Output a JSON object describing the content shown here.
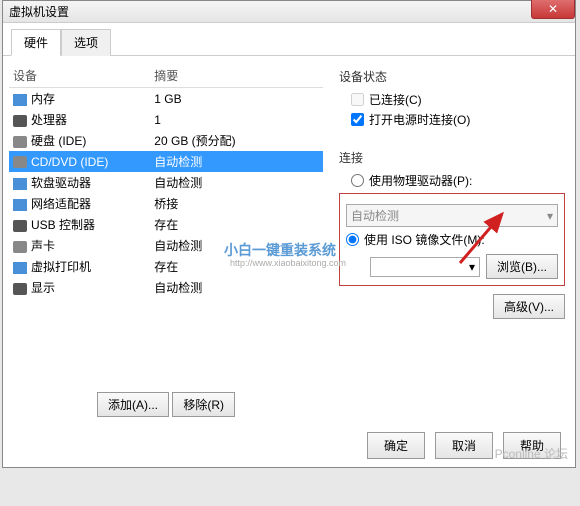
{
  "window_title": "虚拟机设置",
  "tabs": {
    "hardware": "硬件",
    "options": "选项"
  },
  "columns": {
    "device": "设备",
    "summary": "摘要"
  },
  "devices": [
    {
      "name": "内存",
      "summary": "1 GB",
      "icon": "blue"
    },
    {
      "name": "处理器",
      "summary": "1",
      "icon": "dark"
    },
    {
      "name": "硬盘 (IDE)",
      "summary": "20 GB (预分配)",
      "icon": "disk"
    },
    {
      "name": "CD/DVD (IDE)",
      "summary": "自动检测",
      "icon": "disk",
      "selected": true
    },
    {
      "name": "软盘驱动器",
      "summary": "自动检测",
      "icon": "blue"
    },
    {
      "name": "网络适配器",
      "summary": "桥接",
      "icon": "blue"
    },
    {
      "name": "USB 控制器",
      "summary": "存在",
      "icon": "dark"
    },
    {
      "name": "声卡",
      "summary": "自动检测",
      "icon": "disk"
    },
    {
      "name": "虚拟打印机",
      "summary": "存在",
      "icon": "blue"
    },
    {
      "name": "显示",
      "summary": "自动检测",
      "icon": "dark"
    }
  ],
  "buttons": {
    "add": "添加(A)...",
    "remove": "移除(R)",
    "browse": "浏览(B)...",
    "advanced": "高级(V)...",
    "ok": "确定",
    "cancel": "取消",
    "help": "帮助"
  },
  "status_group": {
    "title": "设备状态",
    "connected": "已连接(C)",
    "connect_poweron": "打开电源时连接(O)"
  },
  "connection_group": {
    "title": "连接",
    "physical": "使用物理驱动器(P):",
    "physical_value": "自动检测",
    "iso": "使用 ISO 镜像文件(M):"
  },
  "watermark": {
    "main": "小白一键重装系统",
    "sub": "http://www.xiaobaixitong.com"
  },
  "watermark2": "Pconline  论坛"
}
